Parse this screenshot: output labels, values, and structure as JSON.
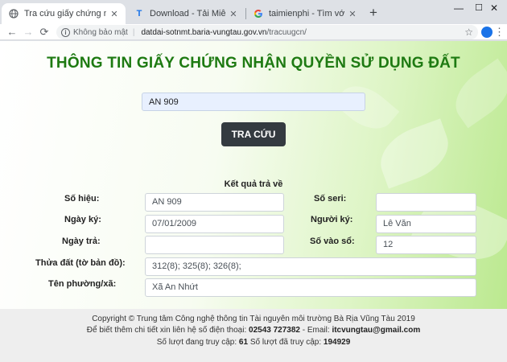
{
  "browser": {
    "tabs": [
      {
        "title": "Tra cứu giấy chứng nhận QSDĐ",
        "icon": "globe-icon",
        "active": true
      },
      {
        "title": "Download - Tải Miễn Phí VN - Ph",
        "icon": "taimienphi-favicon",
        "active": false
      },
      {
        "title": "taimienphi - Tìm với Google",
        "icon": "google-g-icon",
        "active": false
      }
    ],
    "new_tab": "+",
    "window_controls": {
      "minimize": "—",
      "maximize": "☐",
      "close": "✕"
    },
    "nav": {
      "back": "←",
      "forward": "→",
      "reload": "⟳"
    },
    "address": {
      "security_label": "Không bảo mật",
      "host": "datdai-sotnmt.baria-vungtau.gov.vn",
      "path": "/tracuugcn/"
    },
    "star": "☆",
    "menu": "⋮"
  },
  "page": {
    "title": "THÔNG TIN GIẤY CHỨNG NHẬN QUYỀN SỬ DỤNG ĐẤT",
    "search_value": "AN 909",
    "search_button": "TRA CỨU",
    "result_heading": "Kết quả trả về",
    "labels": {
      "so_hieu": "Số hiệu:",
      "so_seri": "Số seri:",
      "ngay_ky": "Ngày ký:",
      "nguoi_ky": "Người ký:",
      "ngay_tra": "Ngày trả:",
      "so_vao_so": "Số vào sổ:",
      "thua_dat": "Thửa đất (tờ bản đồ):",
      "ten_phuong": "Tên phường/xã:"
    },
    "values": {
      "so_hieu": "AN 909",
      "so_seri": "",
      "ngay_ky": "07/01/2009",
      "nguoi_ky": "Lê Văn",
      "ngay_tra": "",
      "so_vao_so": "12",
      "thua_dat": "312(8); 325(8); 326(8);",
      "ten_phuong": "Xã An Nhứt"
    }
  },
  "footer": {
    "copyright": "Copyright © Trung tâm Công nghệ thông tin Tài nguyên môi trường Bà Rịa Vũng Tàu 2019",
    "contact_prefix": "Để biết thêm chi tiết xin liên hệ số điện thoại:",
    "phone": "02543 727382",
    "email_prefix": "- Email:",
    "email": "itcvungtau@gmail.com",
    "visits_prefix": "Số lượt đang truy cập:",
    "visits_now": "61",
    "visits_total_prefix": "Số lượt đã truy cập:",
    "visits_total": "194929"
  },
  "colors": {
    "title_green": "#1e7a12",
    "button_dark": "#343a40",
    "page_gradient_end": "#b9e88c"
  }
}
